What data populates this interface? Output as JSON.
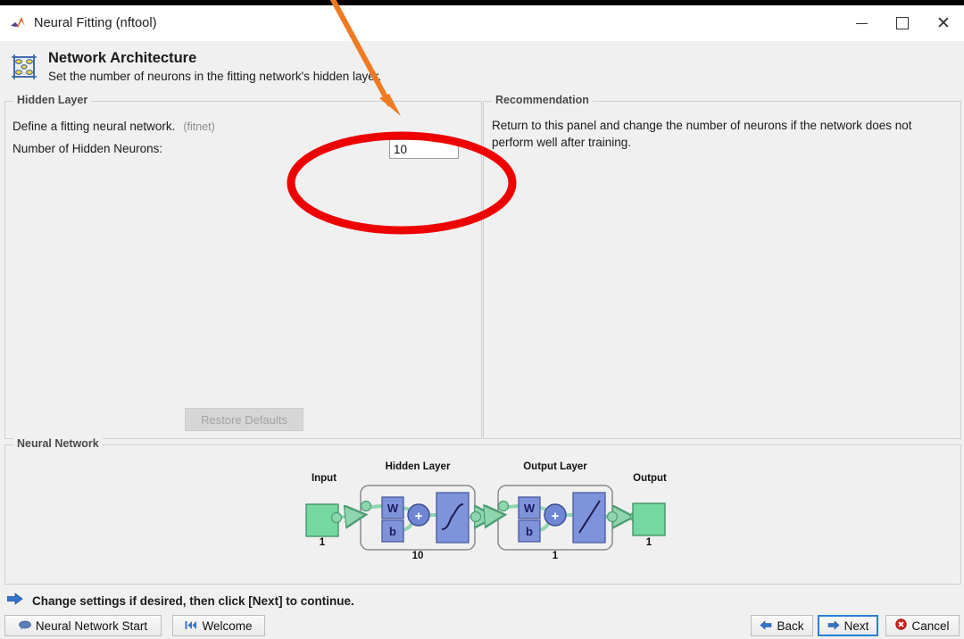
{
  "window": {
    "title": "Neural Fitting (nftool)",
    "app_icon": "matlab-membrane-icon",
    "minimize_label": "–",
    "maximize_label": "□",
    "close_label": "×"
  },
  "header": {
    "icon": "network-architecture-icon",
    "title": "Network Architecture",
    "subtitle": "Set the number of neurons in the fitting network's hidden layer."
  },
  "hidden_layer_panel": {
    "legend": "Hidden Layer",
    "define_text": "Define a fitting neural network.",
    "define_hint": "(fitnet)",
    "neurons_label": "Number of Hidden Neurons:",
    "neurons_value": "10",
    "restore_button": "Restore Defaults",
    "restore_enabled": false
  },
  "recommendation_panel": {
    "legend": "Recommendation",
    "text": "Return to this panel and change the number of neurons if the network does not perform well after training."
  },
  "network_panel": {
    "legend": "Neural Network",
    "diagram": {
      "input_label": "Input",
      "input_size": "1",
      "hidden_layer_label": "Hidden Layer",
      "hidden_layer_size": "10",
      "output_layer_label": "Output Layer",
      "output_layer_size": "1",
      "output_label": "Output",
      "output_size": "1",
      "weight_symbol": "W",
      "bias_symbol": "b",
      "sum_symbol": "+",
      "hidden_transfer": "tansig-sigmoid-icon",
      "output_transfer": "purelin-linear-icon"
    }
  },
  "footer": {
    "hint_icon": "blue-right-arrow-icon",
    "hint_text": "Change settings  if desired, then click [Next] to continue.",
    "left_buttons": [
      {
        "label": "Neural Network Start",
        "icon": "speech-bubble-icon"
      },
      {
        "label": "Welcome",
        "icon": "skip-back-icon"
      }
    ],
    "right_buttons": [
      {
        "label": "Back",
        "icon": "left-arrow-icon",
        "focused": false
      },
      {
        "label": "Next",
        "icon": "right-arrow-icon",
        "focused": true
      },
      {
        "label": "Cancel",
        "icon": "cancel-icon",
        "focused": false
      }
    ]
  },
  "annotations": {
    "ellipse_color": "#ee0000",
    "arrow_color": "#ef7a22"
  },
  "colors": {
    "window_bg": "#f0f0f0",
    "titlebar_bg": "#ffffff",
    "panel_border": "#cfcfcf",
    "accent_blue": "#2a7fd4",
    "node_blue": "#7f93da",
    "link_green": "#8fd6ae",
    "io_green": "#74d8a0"
  }
}
